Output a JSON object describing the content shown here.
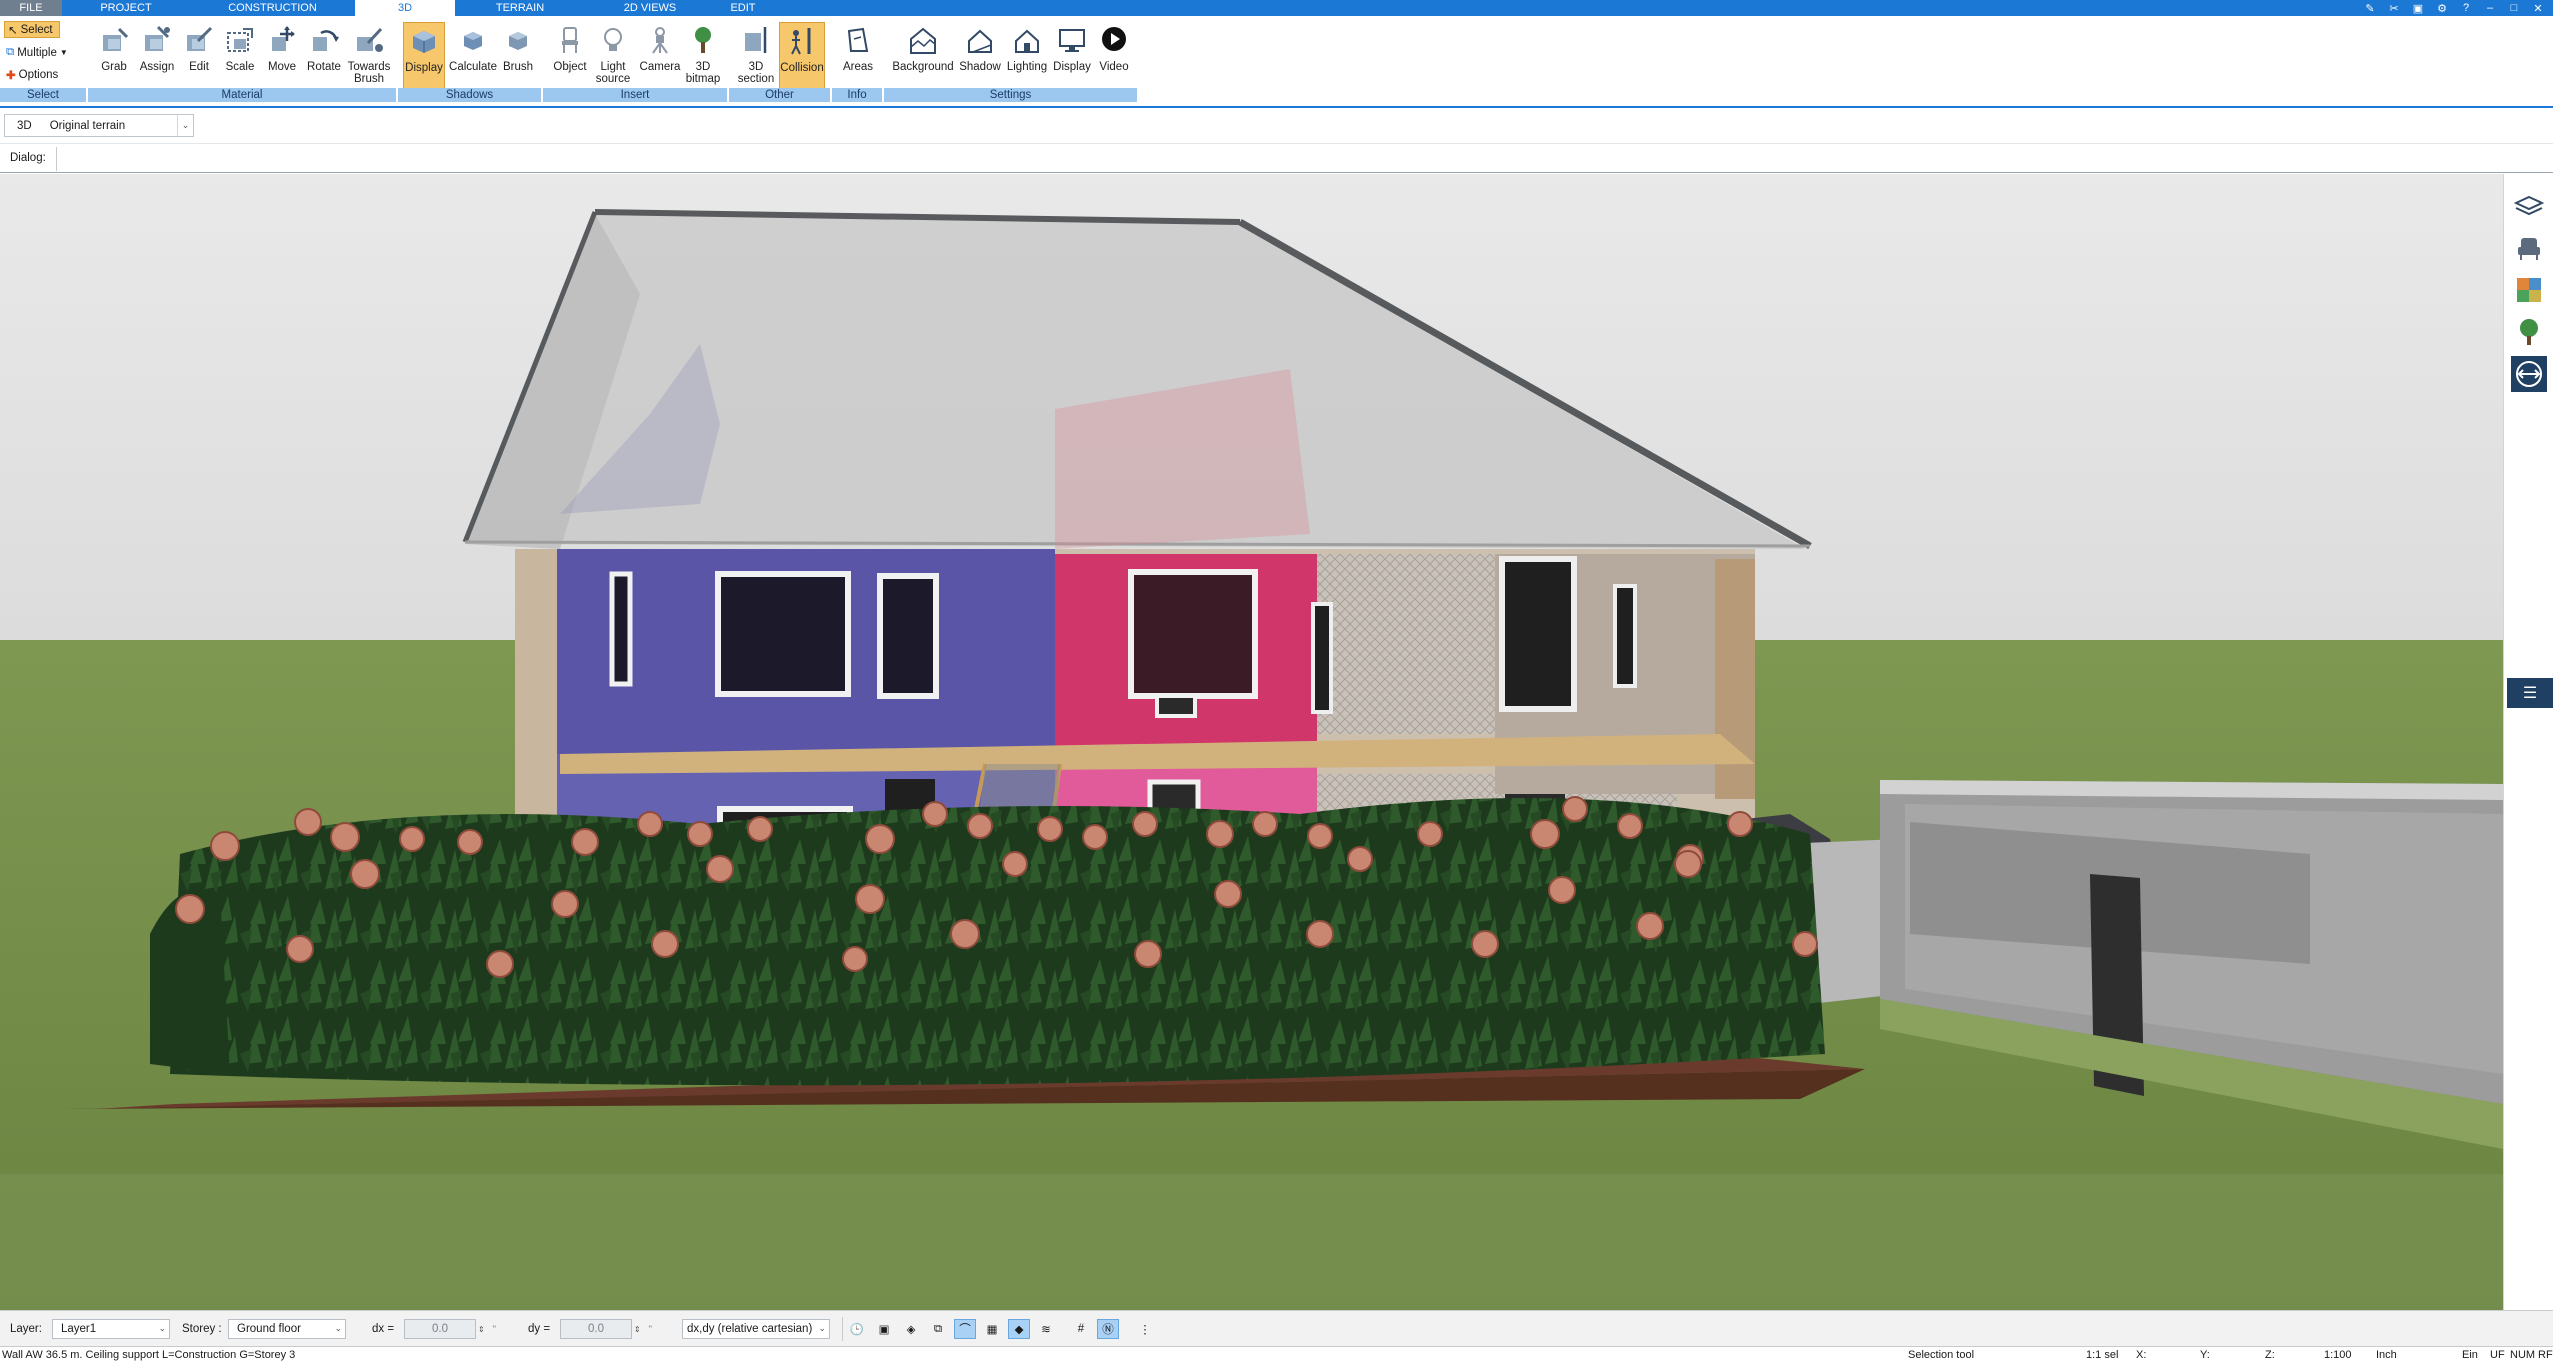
{
  "menu": {
    "tabs": [
      "FILE",
      "PROJECT",
      "CONSTRUCTION",
      "3D",
      "TERRAIN",
      "2D VIEWS",
      "EDIT"
    ],
    "active_tab": "3D"
  },
  "ribbon": {
    "select": {
      "select_label": "Select",
      "multiple_label": "Multiple",
      "options_label": "Options"
    },
    "buttons": {
      "grab": "Grab",
      "assign": "Assign",
      "edit": "Edit",
      "scale": "Scale",
      "move": "Move",
      "rotate": "Rotate",
      "towards_brush_1": "Towards",
      "towards_brush_2": "Brush",
      "display": "Display",
      "calculate": "Calculate",
      "brush": "Brush",
      "object": "Object",
      "light_source_1": "Light",
      "light_source_2": "source",
      "camera": "Camera",
      "bitmap_1": "3D",
      "bitmap_2": "bitmap",
      "section_1": "3D",
      "section_2": "section",
      "collision": "Collision",
      "areas": "Areas",
      "background": "Background",
      "shadow": "Shadow",
      "lighting": "Lighting",
      "display2": "Display",
      "video": "Video"
    },
    "groups": {
      "select": "Select",
      "material": "Material",
      "shadows": "Shadows",
      "insert": "Insert",
      "other": "Other",
      "info": "Info",
      "settings": "Settings"
    }
  },
  "view": {
    "mode_label": "3D",
    "terrain_value": "Original terrain",
    "dialog_label": "Dialog:"
  },
  "toolbar": {
    "layer_label": "Layer:",
    "layer_value": "Layer1",
    "storey_label": "Storey :",
    "storey_value": "Ground floor",
    "dx_label": "dx =",
    "dx_value": "0.0",
    "dy_label": "dy =",
    "dy_value": "0.0",
    "coord_mode": "dx,dy (relative cartesian)"
  },
  "status": {
    "message": "Wall AW 36.5 m. Ceiling support L=Construction G=Storey 3",
    "tool": "Selection tool",
    "selection": "1:1 sel",
    "x_label": "X:",
    "y_label": "Y:",
    "z_label": "Z:",
    "scale": "1:100",
    "unit": "Inch",
    "ein": "Ein",
    "uf": "UF",
    "num": "NUM",
    "rf": "RF"
  },
  "colors": {
    "accent": "#1b78d4",
    "active_button": "#f7c86b",
    "group_bar": "#9cc8f0"
  }
}
